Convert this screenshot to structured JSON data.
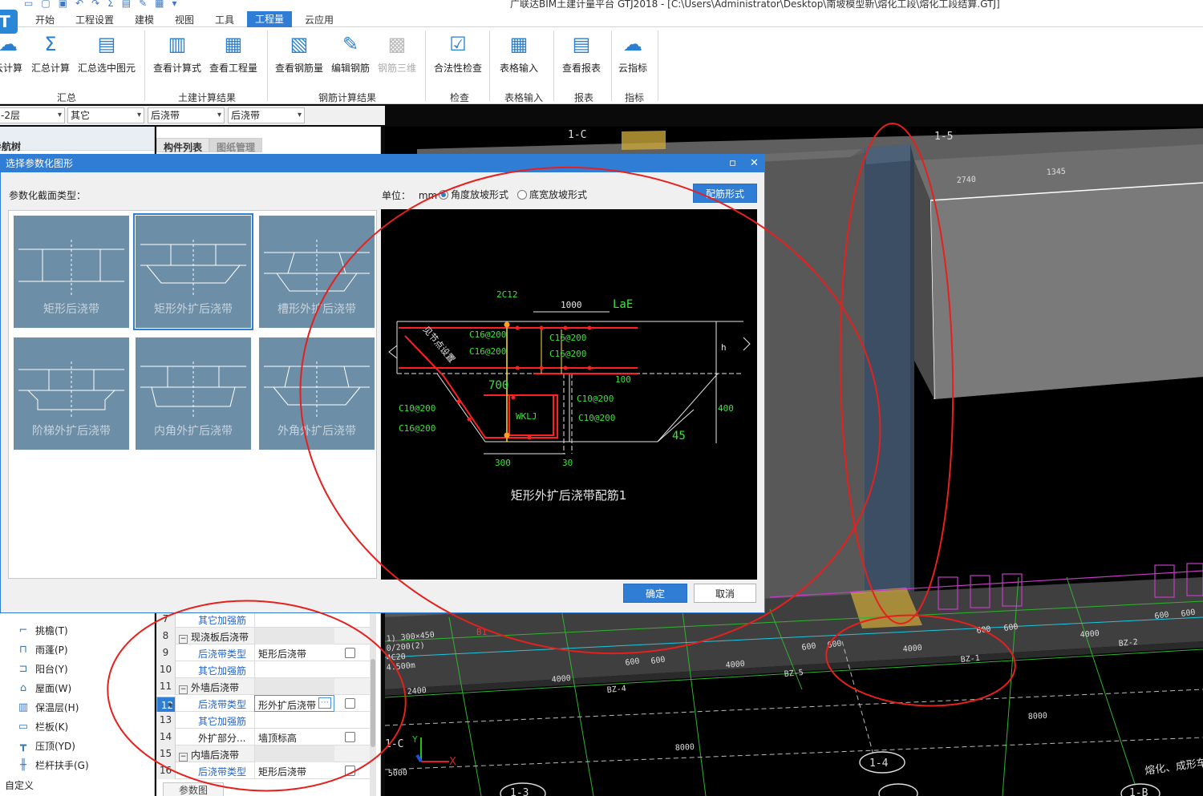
{
  "window": {
    "title": "广联达BIM土建计量平台 GTJ2018 - [C:\\Users\\Administrator\\Desktop\\南坡模型新\\熔化工段\\熔化工段结算.GTJ]",
    "logo": "T"
  },
  "menu": [
    "开始",
    "工程设置",
    "建模",
    "视图",
    "工具",
    "工程量",
    "云应用"
  ],
  "ribbon": {
    "buttons": [
      {
        "label": "云计算",
        "icon": "cloud-calc-icon"
      },
      {
        "label": "汇总计算",
        "icon": "sigma-icon"
      },
      {
        "label": "汇总选中图元",
        "icon": "summary-selected-icon"
      },
      {
        "label": "查看计算式",
        "icon": "view-formula-icon"
      },
      {
        "label": "查看工程量",
        "icon": "view-quantity-icon"
      },
      {
        "label": "查看钢筋量",
        "icon": "view-rebar-icon"
      },
      {
        "label": "编辑钢筋",
        "icon": "edit-rebar-icon"
      },
      {
        "label": "钢筋三维",
        "icon": "rebar-3d-icon"
      },
      {
        "label": "合法性检查",
        "icon": "check-icon"
      },
      {
        "label": "表格输入",
        "icon": "table-input-icon"
      },
      {
        "label": "查看报表",
        "icon": "report-icon"
      },
      {
        "label": "云指标",
        "icon": "cloud-index-icon"
      }
    ],
    "groups": [
      "汇总",
      "土建计算结果",
      "钢筋计算结果",
      "检查",
      "表格输入",
      "报表",
      "指标"
    ]
  },
  "selectors": [
    "-2层",
    "其它",
    "后浇带",
    "后浇带"
  ],
  "left_panel": {
    "title": "导航树",
    "items": [
      {
        "label": "挑檐(T)",
        "icon": "eave-icon"
      },
      {
        "label": "雨蓬(P)",
        "icon": "canopy-icon"
      },
      {
        "label": "阳台(Y)",
        "icon": "balcony-icon"
      },
      {
        "label": "屋面(W)",
        "icon": "roof-icon"
      },
      {
        "label": "保温层(H)",
        "icon": "insulation-icon"
      },
      {
        "label": "栏板(K)",
        "icon": "parapet-icon"
      },
      {
        "label": "压顶(YD)",
        "icon": "coping-icon"
      },
      {
        "label": "栏杆扶手(G)",
        "icon": "railing-icon"
      }
    ],
    "footer": "自定义"
  },
  "mid_panel": {
    "tabs": [
      "构件列表",
      "图纸管理"
    ],
    "rows": [
      {
        "num": "7",
        "name": "其它加强筋",
        "value": "",
        "link": true,
        "check": false
      },
      {
        "num": "8",
        "name": "现浇板后浇带",
        "value": "",
        "group": true
      },
      {
        "num": "9",
        "name": "后浇带类型",
        "value": "矩形后浇带",
        "link": true,
        "check": true
      },
      {
        "num": "10",
        "name": "其它加强筋",
        "value": "",
        "link": true,
        "check": false
      },
      {
        "num": "11",
        "name": "外墙后浇带",
        "value": "",
        "group": true
      },
      {
        "num": "12",
        "name": "后浇带类型",
        "value": "形外扩后浇带",
        "link": true,
        "check": true,
        "selected": true
      },
      {
        "num": "13",
        "name": "其它加强筋",
        "value": "",
        "link": true,
        "check": false
      },
      {
        "num": "14",
        "name": "外扩部分...",
        "value": "墙顶标高",
        "link": false,
        "check": true
      },
      {
        "num": "15",
        "name": "内墙后浇带",
        "value": "",
        "group": true
      },
      {
        "num": "16",
        "name": "后浇带类型",
        "value": "矩形后浇带",
        "link": true,
        "check": true
      }
    ],
    "bottom_tab": "参数图"
  },
  "dialog": {
    "title": "选择参数化图形",
    "section_label": "参数化截面类型：",
    "unit_label": "单位：",
    "unit": "mm",
    "radio_angle": "角度放坡形式",
    "radio_width": "底宽放坡形式",
    "config_button": "配筋形式",
    "ok_button": "确定",
    "cancel_button": "取消",
    "shapes": [
      "矩形后浇带",
      "矩形外扩后浇带",
      "槽形外扩后浇带",
      "阶梯外扩后浇带",
      "内角外扩后浇带",
      "外角外扩后浇带"
    ],
    "selected_shape": 1,
    "preview": {
      "caption": "矩形外扩后浇带配筋1",
      "labels": {
        "top_bar": "2C12",
        "len": "1000",
        "lae": "LaE",
        "c16a": "C16@200",
        "c16b": "C16@200",
        "c16c": "C16@200",
        "c16d": "C16@200",
        "h": "h",
        "d100": "100",
        "d700": "700",
        "c10a": "C10@200",
        "c10b": "C10@200",
        "c10c": "C10@200",
        "c16e": "C16@200",
        "wklj": "WKLJ",
        "d400": "400",
        "angle": "45",
        "d300": "300",
        "d30": "30",
        "diag": "见节点设置"
      }
    }
  },
  "view3d": {
    "dims": [
      "2740",
      "1345",
      "600",
      "600",
      "600",
      "600",
      "600",
      "600",
      "600",
      "600",
      "4000",
      "4000",
      "4000",
      "4000",
      "4000",
      "2400",
      "8000",
      "8000",
      "5000"
    ],
    "axis_labels": [
      "1-C",
      "1-5",
      "1-4",
      "1-3",
      "1-B"
    ],
    "beam_labels": [
      "BZ-4",
      "BZ-5",
      "BZ-1",
      "BZ-2"
    ],
    "corner_text": "熔化、成形车",
    "misc": [
      "1) 300×450",
      "0/200(2)",
      "4C20",
      "4.500m",
      "B1"
    ]
  },
  "colors": {
    "accent": "#2f7dd4",
    "annotation": "#e5201d",
    "thumb_bg": "#6c8ea6",
    "preview_bg": "#000000",
    "cad_green": "#39e639",
    "cad_red": "#ff2020"
  }
}
